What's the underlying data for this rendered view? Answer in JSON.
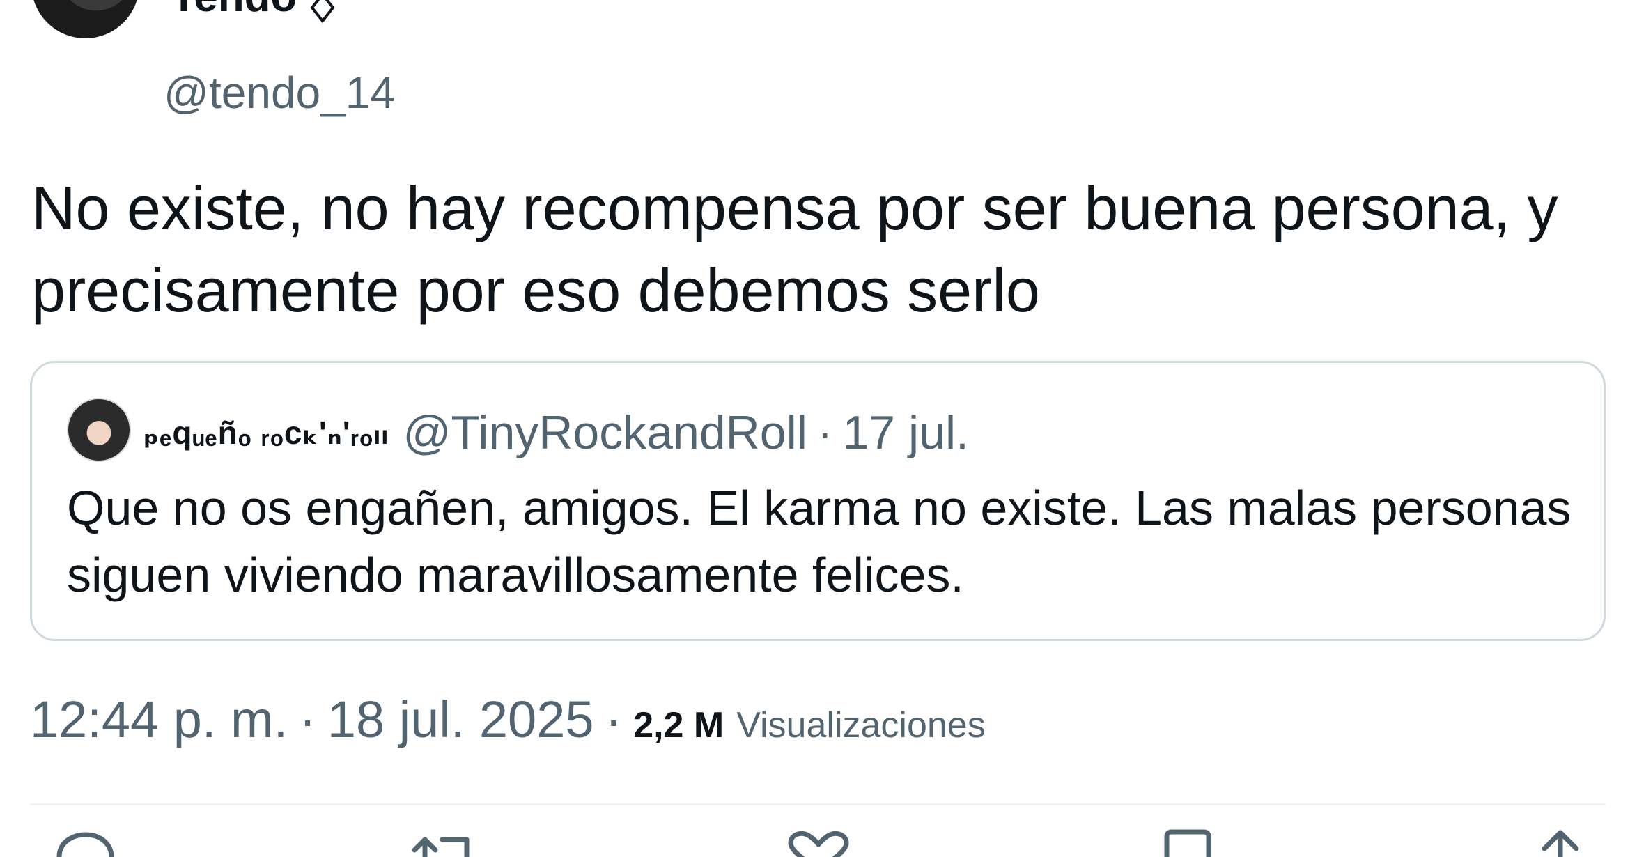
{
  "author": {
    "display_name": "Tendo",
    "handle": "@tendo_14",
    "badge_icon": "diamond-badge-icon"
  },
  "tweet": {
    "text": "No existe, no hay recompensa por ser buena persona, y precisamente por eso debemos serlo"
  },
  "quoted_tweet": {
    "display_name": "ₚₑqᵤₑñₒ ᵣₒcₖ'ₙ'ᵣₒₗₗ",
    "handle": "@TinyRockandRoll",
    "separator": "·",
    "date": "17 jul.",
    "text": "Que no os engañen, amigos. El karma no existe. Las malas personas siguen viviendo maravillosamente felices."
  },
  "meta": {
    "time": "12:44 p. m.",
    "separator": "·",
    "date": "18 jul. 2025",
    "views_count": "2,2 M",
    "views_label": "Visualizaciones"
  },
  "actions": [
    {
      "name": "reply-icon"
    },
    {
      "name": "repost-icon"
    },
    {
      "name": "like-icon"
    },
    {
      "name": "bookmark-icon"
    },
    {
      "name": "share-icon"
    }
  ],
  "colors": {
    "text_primary": "#0f1419",
    "text_secondary": "#536471",
    "border": "#cfd9de",
    "divider": "#eff3f4"
  }
}
